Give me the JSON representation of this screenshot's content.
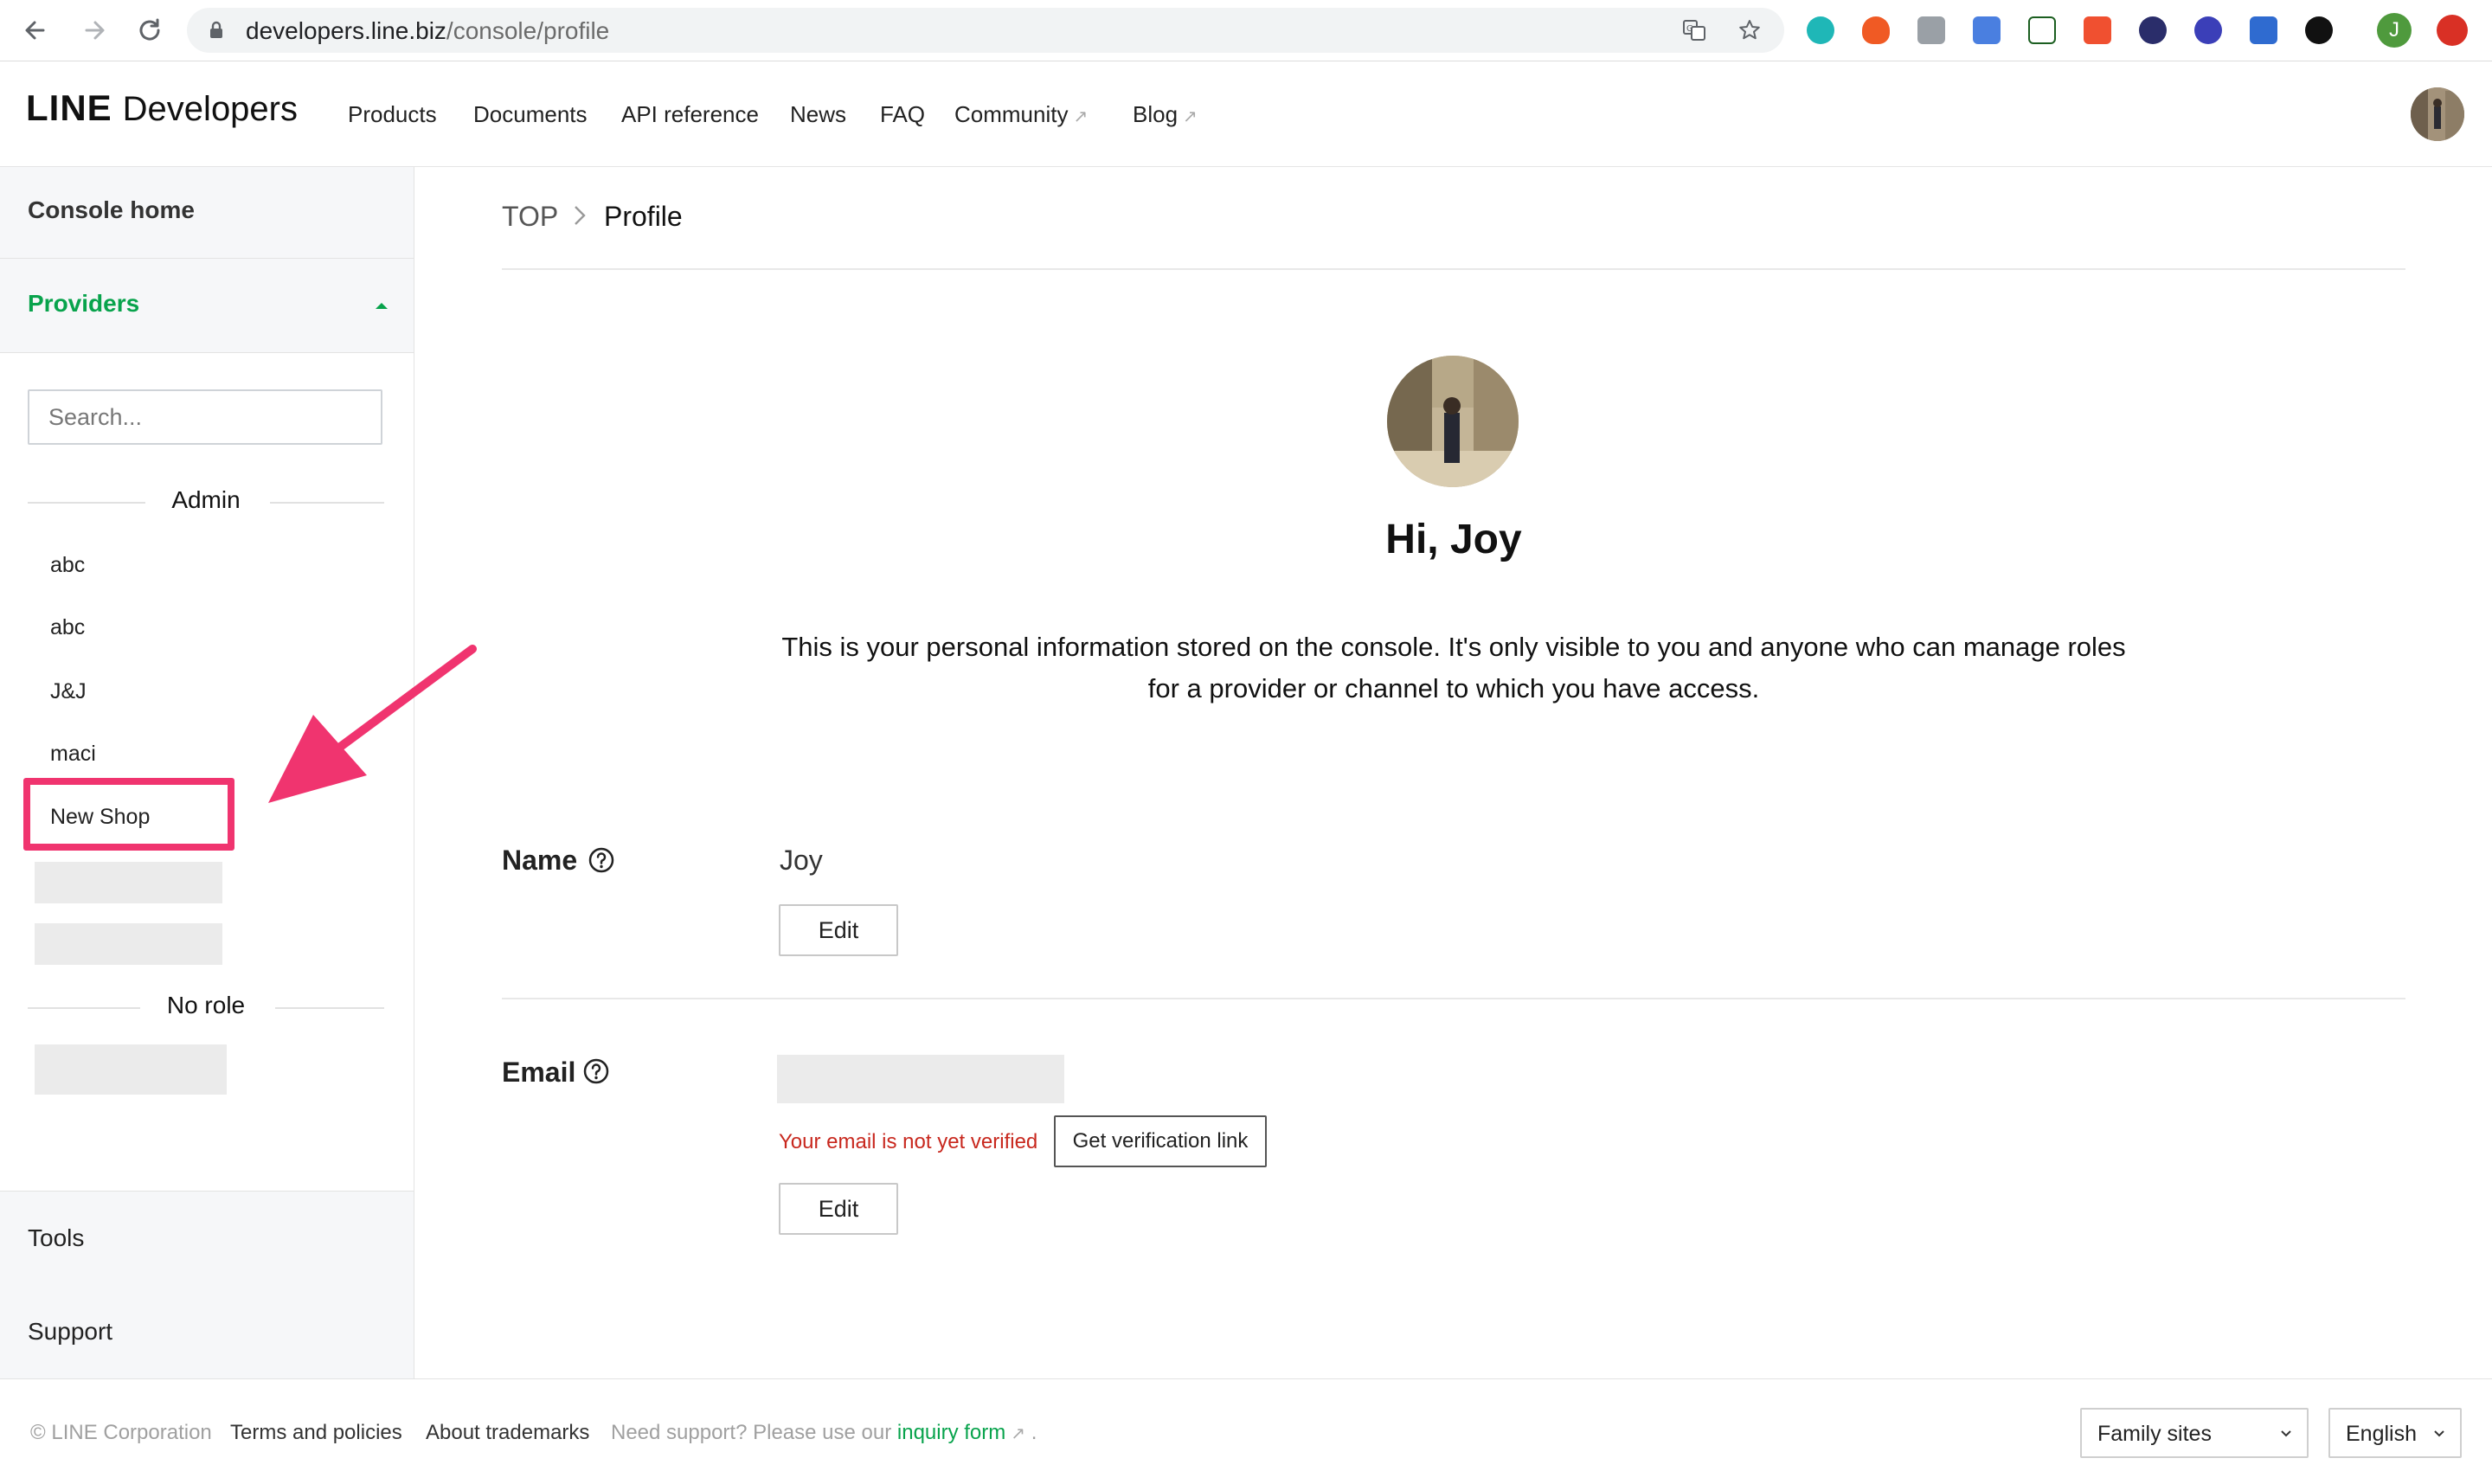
{
  "browser": {
    "url_host": "developers.line.biz",
    "url_path": "/console/profile",
    "profile_initial": "J"
  },
  "header": {
    "logo_primary": "LINE",
    "logo_secondary": "Developers",
    "nav": [
      {
        "label": "Products"
      },
      {
        "label": "Documents"
      },
      {
        "label": "API reference"
      },
      {
        "label": "News"
      },
      {
        "label": "FAQ"
      },
      {
        "label": "Community",
        "external": true
      },
      {
        "label": "Blog",
        "external": true
      }
    ]
  },
  "sidebar": {
    "console_home": "Console home",
    "providers_label": "Providers",
    "search_placeholder": "Search...",
    "admin_heading": "Admin",
    "admin_items": [
      "abc",
      "abc",
      "J&J",
      "maci",
      "New Shop"
    ],
    "no_role_heading": "No role",
    "tools": "Tools",
    "support": "Support",
    "accent_color": "#08a34c",
    "annotation_color": "#f0346f"
  },
  "breadcrumb": {
    "top": "TOP",
    "current": "Profile"
  },
  "profile": {
    "greeting": "Hi, Joy",
    "description_line1": "This is your personal information stored on the console. It's only visible to you and anyone who can manage roles",
    "description_line2": "for a provider or channel to which you have access.",
    "name_label": "Name",
    "name_value": "Joy",
    "name_edit": "Edit",
    "email_label": "Email",
    "email_warning": "Your email is not yet verified",
    "verify_button": "Get verification link",
    "email_edit": "Edit",
    "warning_color": "#c8281e"
  },
  "footer": {
    "copyright": "© LINE Corporation",
    "terms": "Terms and policies",
    "trademarks": "About trademarks",
    "support_prefix": "Need support? Please use our",
    "inquiry_link": "inquiry form",
    "support_suffix": ".",
    "family_sites": "Family sites",
    "language": "English"
  }
}
